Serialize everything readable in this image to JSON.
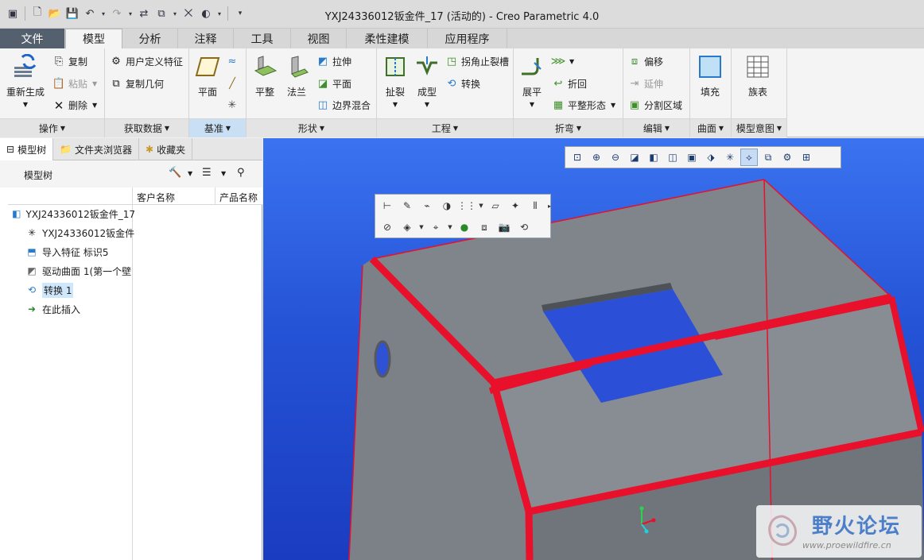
{
  "window": {
    "title": "YXJ24336012钣金件_17 (活动的) - Creo Parametric 4.0"
  },
  "quick_access": [
    "new-icon",
    "open-icon",
    "save-icon",
    "undo-icon",
    "redo-icon",
    "regenerate-icon",
    "window-icon",
    "close-icon",
    "appearance-icon",
    "customize-icon"
  ],
  "tabs": [
    {
      "label": "文件",
      "width": 82
    },
    {
      "label": "模型",
      "width": 72
    },
    {
      "label": "分析",
      "width": 70
    },
    {
      "label": "注释",
      "width": 70
    },
    {
      "label": "工具",
      "width": 72
    },
    {
      "label": "视图",
      "width": 70
    },
    {
      "label": "柔性建模",
      "width": 102
    },
    {
      "label": "应用程序",
      "width": 100
    }
  ],
  "ribbon": {
    "ops": {
      "label": "操作",
      "regenerate": "重新生成",
      "copy": "复制",
      "paste": "粘贴",
      "delete": "删除"
    },
    "getdata": {
      "label": "获取数据",
      "udf": "用户定义特征",
      "copy_geom": "复制几何"
    },
    "datum": {
      "label": "基准",
      "plane": "平面"
    },
    "shapes": {
      "label": "形状",
      "flat": "平整",
      "flange": "法兰",
      "extrude": "拉伸",
      "plane": "平面",
      "blend": "边界混合"
    },
    "engineering": {
      "label": "工程",
      "rip": "扯裂",
      "form": "成型",
      "corner_relief": "拐角止裂槽",
      "convert": "转换"
    },
    "bends": {
      "label": "折弯",
      "unbend": "展平",
      "bend_back": "折回",
      "flat_pattern": "平整形态"
    },
    "editing": {
      "label": "编辑",
      "offset": "偏移",
      "extend": "延伸",
      "split": "分割区域"
    },
    "surfaces": {
      "label": "曲面",
      "fill": "填充"
    },
    "intent": {
      "label": "模型意图",
      "family": "族表"
    }
  },
  "panel": {
    "tabs": [
      "模型树",
      "文件夹浏览器",
      "收藏夹"
    ],
    "toolbar_title": "模型树",
    "columns": [
      "客户名称",
      "产品名称"
    ],
    "tree": [
      {
        "label": "YXJ24336012钣金件_17",
        "icon": "part-icon"
      },
      {
        "label": "YXJ24336012钣金件",
        "icon": "csys-icon"
      },
      {
        "label": "导入特征 标识5",
        "icon": "import-feature-icon"
      },
      {
        "label": "驱动曲面 1(第一个壁",
        "icon": "driving-surface-icon"
      },
      {
        "label": "转换 1",
        "icon": "convert-icon",
        "selected": true
      },
      {
        "label": "在此插入",
        "icon": "insert-here-icon"
      }
    ]
  },
  "watermark": {
    "cn": "野火论坛",
    "url": "www.proewildfire.cn"
  },
  "colors": {
    "accent": "#4b7fc9",
    "edge": "#e8102a",
    "face": "#7f858b",
    "bg_top": "#3a73f0",
    "bg_bottom": "#1a3cc0"
  }
}
